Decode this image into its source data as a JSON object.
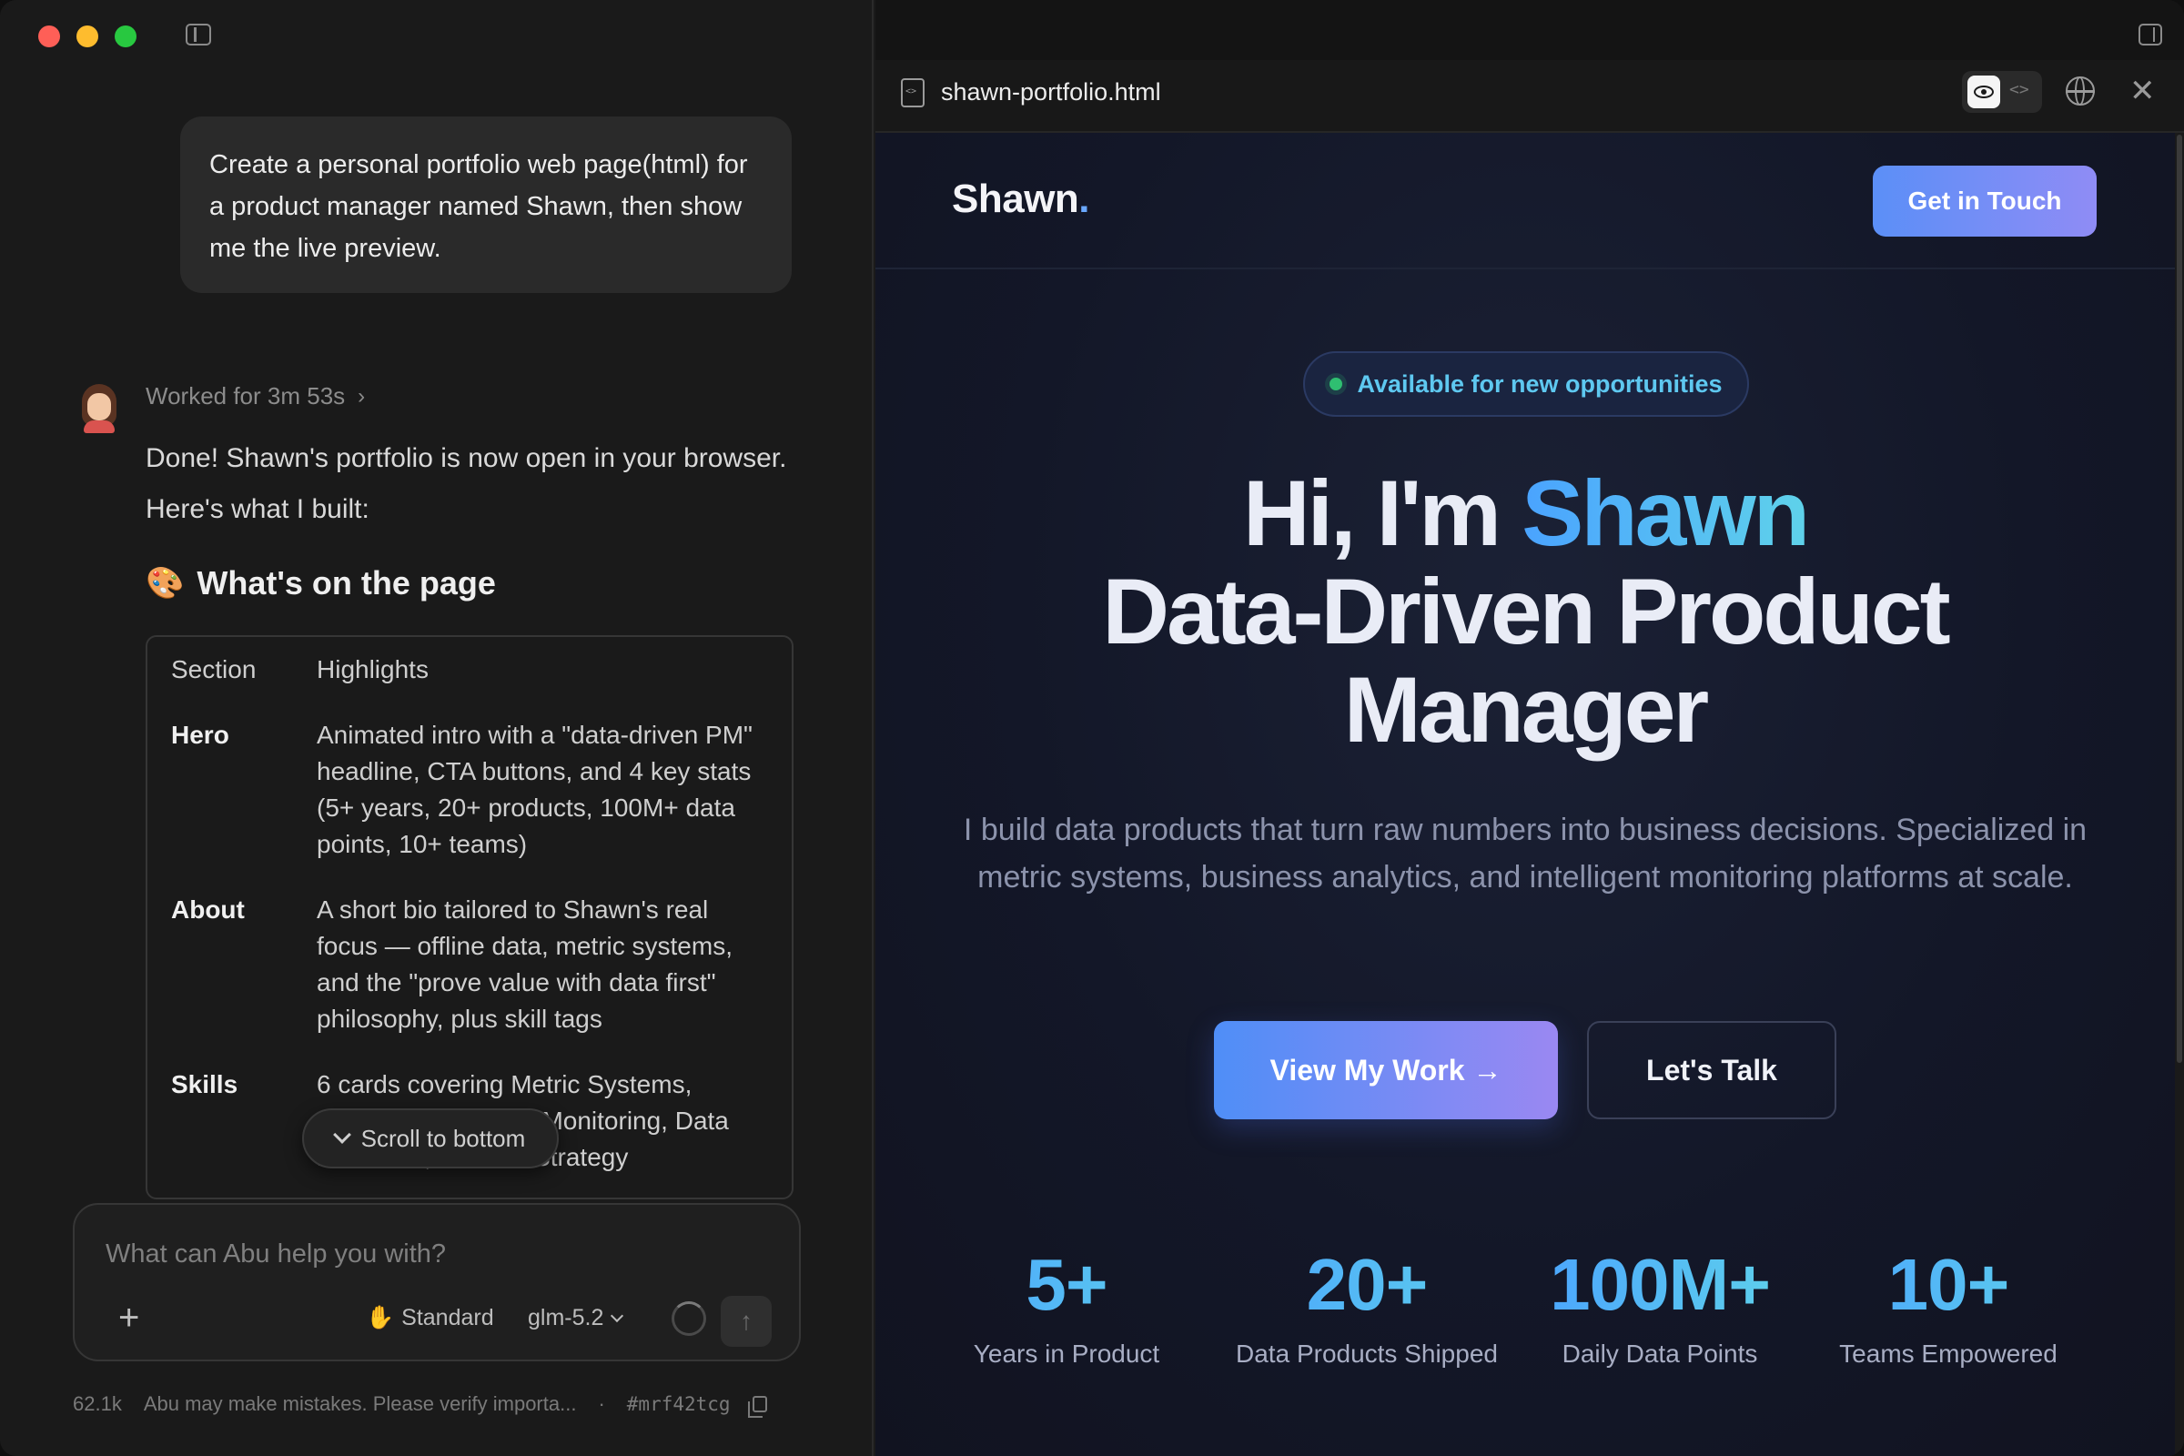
{
  "chat": {
    "user_message": "Create a personal portfolio web page(html) for a product manager named Shawn, then show me the live preview.",
    "worked_for": "Worked for 3m 53s",
    "assistant_intro": "Done! Shawn's portfolio is now open in your browser. Here's what I built:",
    "section_heading": "What's on the page",
    "section_emoji": "🎨",
    "table": {
      "col_section": "Section",
      "col_highlights": "Highlights",
      "rows": [
        {
          "name": "Hero",
          "desc": "Animated intro with a \"data-driven PM\" headline, CTA buttons, and 4 key stats (5+ years, 20+ products, 100M+ data points, 10+ teams)"
        },
        {
          "name": "About",
          "desc": "A short bio tailored to Shawn's real focus — offline data, metric systems, and the \"prove value with data first\" philosophy, plus skill tags"
        },
        {
          "name": "Skills",
          "desc": "6 cards covering Metric Systems, Business Analytics, Monitoring, Data Platforms, Product Strategy"
        }
      ]
    },
    "scroll_to_bottom": "Scroll to bottom"
  },
  "composer": {
    "placeholder": "What can Abu help you with?",
    "add_label": "+",
    "mode_label": "Standard",
    "model_label": "glm-5.2"
  },
  "footer": {
    "tokens": "62.1k",
    "disclaimer": "Abu may make mistakes. Please verify importa...",
    "separator": "·",
    "session_id": "#mrf42tcg"
  },
  "preview": {
    "file_name": "shawn-portfolio.html",
    "code_toggle": "<>",
    "close_label": "✕"
  },
  "site": {
    "brand": "Shawn",
    "brand_dot": ".",
    "nav_cta": "Get in Touch",
    "badge": "Available for new opportunities",
    "hero_prefix": "Hi, I'm ",
    "hero_name": "Shawn",
    "hero_line2": "Data-Driven Product",
    "hero_line3": "Manager",
    "subtitle": "I build data products that turn raw numbers into business decisions. Specialized in metric systems, business analytics, and intelligent monitoring platforms at scale.",
    "primary_cta": "View My Work →",
    "secondary_cta": "Let's Talk",
    "stats": [
      {
        "value": "5+",
        "label": "Years in Product"
      },
      {
        "value": "20+",
        "label": "Data Products Shipped"
      },
      {
        "value": "100M+",
        "label": "Daily Data Points"
      },
      {
        "value": "10+",
        "label": "Teams Empowered"
      }
    ]
  },
  "colors": {
    "accent_blue": "#4aa3ff",
    "accent_cyan": "#5fd2ea",
    "accent_violet": "#9a88f2",
    "badge_green": "#2fbf71"
  }
}
